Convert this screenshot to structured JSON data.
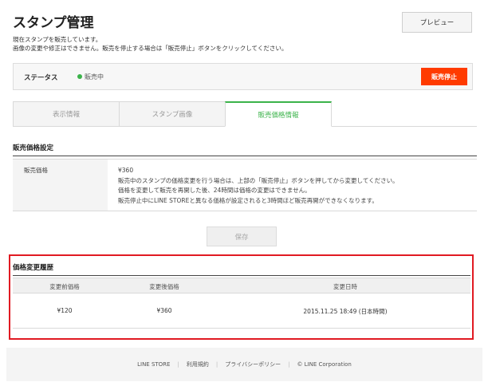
{
  "header": {
    "title": "スタンプ管理",
    "preview_label": "プレビュー",
    "intro_lines": [
      "現在スタンプを販売しています。",
      "画像の変更や修正はできません。販売を停止する場合は「販売停止」ボタンをクリックしてください。"
    ]
  },
  "status": {
    "label": "ステータス",
    "value": "販売中",
    "dot_color": "#3bb34a",
    "stop_label": "販売停止",
    "stop_color": "#ff3b00"
  },
  "tabs": [
    {
      "label": "表示情報",
      "active": false
    },
    {
      "label": "スタンプ画像",
      "active": false
    },
    {
      "label": "販売価格情報",
      "active": true
    }
  ],
  "price_settings": {
    "section_title": "販売価格設定",
    "row_label": "販売価格",
    "price": "¥360",
    "notes": [
      "販売中のスタンプの価格変更を行う場合は、上部の「販売停止」ボタンを押してから変更してください。",
      "価格を変更して販売を再開した後、24時間は価格の変更はできません。",
      "販売停止中にLINE STOREと異なる価格が設定されると3時間ほど販売再開ができなくなります。"
    ]
  },
  "save_label": "保存",
  "history": {
    "section_title": "価格変更履歴",
    "columns": [
      "変更前価格",
      "変更後価格",
      "変更日時"
    ],
    "rows": [
      [
        "¥120",
        "¥360",
        "2015.11.25 18:49 (日本時間)"
      ]
    ],
    "highlight_color": "#e11a22"
  },
  "footer": {
    "links": [
      "LINE STORE",
      "利用規約",
      "プライバシーポリシー"
    ],
    "copyright": "© LINE Corporation"
  },
  "accent_color": "#3bb34a"
}
